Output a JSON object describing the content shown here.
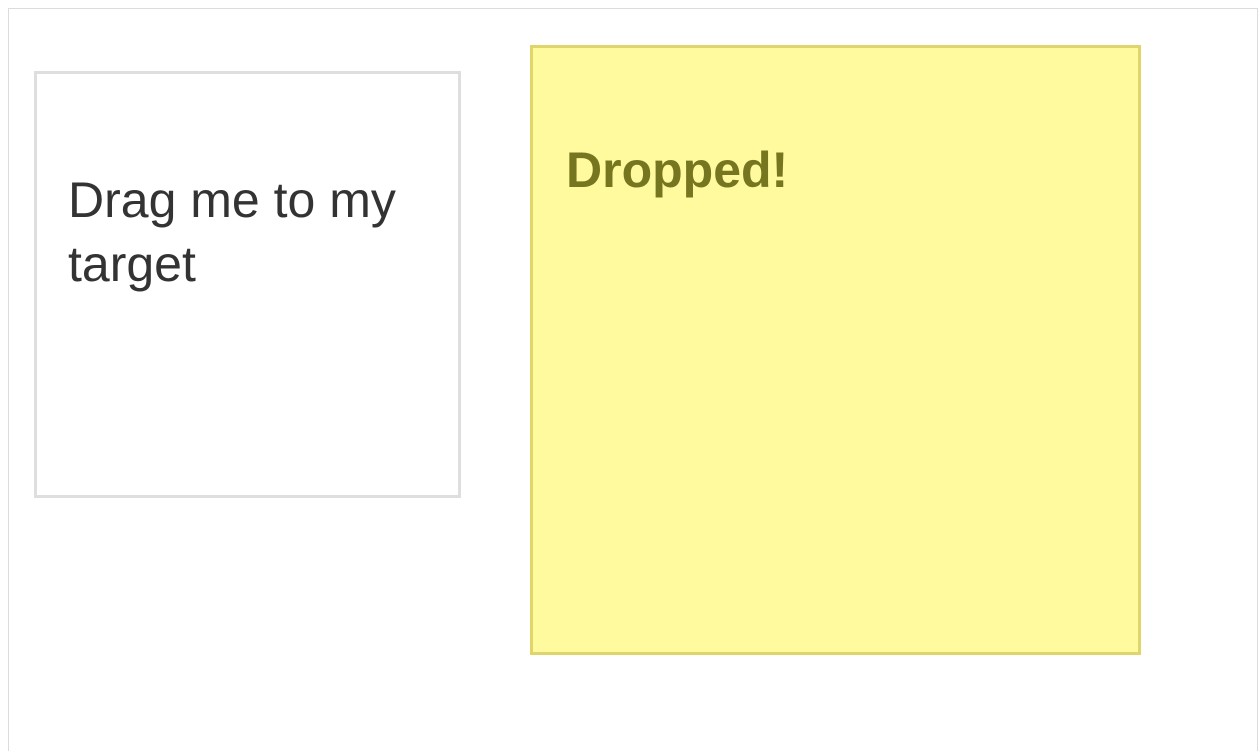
{
  "draggable": {
    "label": "Drag me to my target"
  },
  "droppable": {
    "label": "Dropped!"
  },
  "colors": {
    "drop_background": "#fffa9e",
    "drop_border": "#e0d56a",
    "drop_text": "#777620",
    "drag_border": "#dedede",
    "drag_text": "#333333"
  }
}
